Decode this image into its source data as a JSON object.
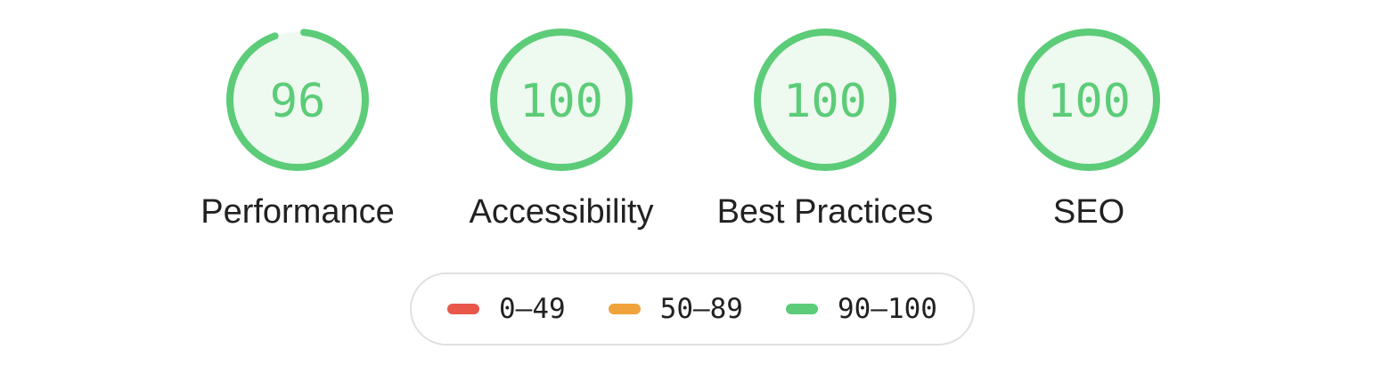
{
  "colors": {
    "pass": "#0cce6b",
    "pass_display": "#5ccc78",
    "pass_fill": "#eef9f0",
    "average": "#f0a33a",
    "fail": "#e8574a",
    "text": "#212121",
    "legend_border": "#e0e0e0"
  },
  "gauges": [
    {
      "score": "96",
      "label": "Performance",
      "value": 96
    },
    {
      "score": "100",
      "label": "Accessibility",
      "value": 100
    },
    {
      "score": "100",
      "label": "Best Practices",
      "value": 100
    },
    {
      "score": "100",
      "label": "SEO",
      "value": 100
    }
  ],
  "legend": [
    {
      "range": "0–49",
      "color": "#e8574a"
    },
    {
      "range": "50–89",
      "color": "#f0a33a"
    },
    {
      "range": "90–100",
      "color": "#5ccc78"
    }
  ]
}
